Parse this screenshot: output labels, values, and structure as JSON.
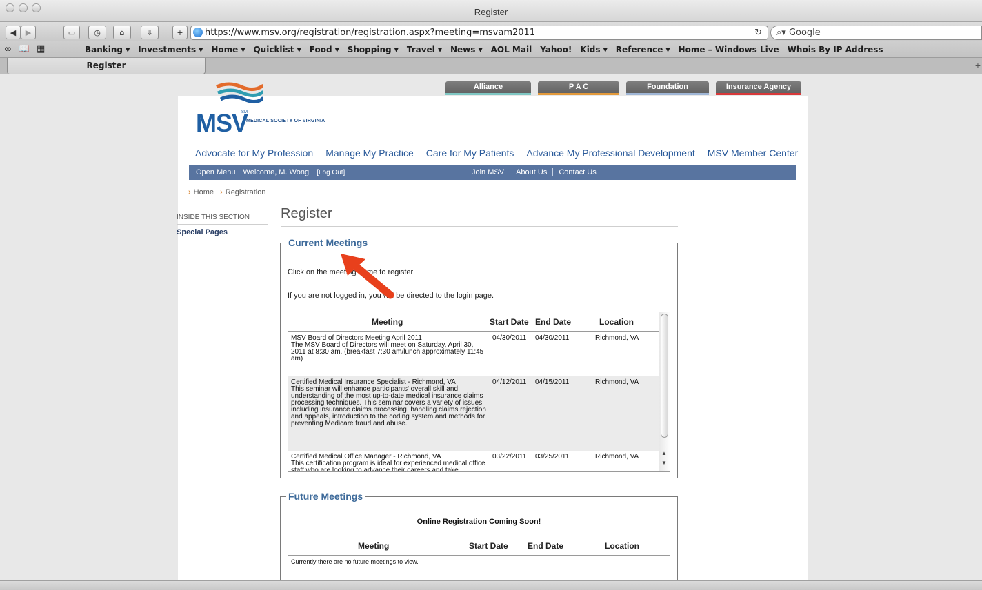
{
  "browser": {
    "window_title": "Register",
    "url": "https://www.msv.org/registration/registration.aspx?meeting=msvam2011",
    "search_placeholder": "Google",
    "bookmarks": [
      "Banking ▾",
      "Investments ▾",
      "Home ▾",
      "Quicklist ▾",
      "Food ▾",
      "Shopping ▾",
      "Travel ▾",
      "News ▾",
      "AOL Mail",
      "Yahoo!",
      "Kids ▾",
      "Reference ▾",
      "Home – Windows Live",
      "Whois By IP Address"
    ],
    "tab_title": "Register"
  },
  "affiliates": [
    {
      "label": "Alliance",
      "color": "#7fc7c3"
    },
    {
      "label": "P A C",
      "color": "#e39a3b"
    },
    {
      "label": "Foundation",
      "color": "#9fb6d6"
    },
    {
      "label": "Insurance Agency",
      "color": "#d8393a"
    }
  ],
  "logo": {
    "text": "MSV",
    "sm": "SM",
    "subtitle": "MEDICAL SOCIETY OF VIRGINIA"
  },
  "main_nav": [
    "Advocate for My Profession",
    "Manage My Practice",
    "Care for My Patients",
    "Advance My Professional Development",
    "MSV Member Center"
  ],
  "blue_bar": {
    "open_menu": "Open Menu",
    "welcome": "Welcome, M. Wong",
    "logout": "[Log Out]",
    "links": [
      "Join MSV",
      "About Us",
      "Contact Us"
    ]
  },
  "breadcrumb": [
    "Home",
    "Registration"
  ],
  "sidebar": {
    "heading": "INSIDE THIS SECTION",
    "link": "Special Pages"
  },
  "page_title": "Register",
  "current_meetings": {
    "legend": "Current Meetings",
    "instruction": "Click on the meeting name to register",
    "login_note": "If you are not logged in, you will be directed to the login page.",
    "columns": [
      "Meeting",
      "Start Date",
      "End Date",
      "Location"
    ],
    "rows": [
      {
        "title": "MSV Board of Directors Meeting April 2011",
        "desc": "The MSV Board of Directors will meet on Saturday, April 30, 2011 at 8:30 am. (breakfast 7:30 am/lunch approximately 11:45 am)",
        "start": "04/30/2011",
        "end": "04/30/2011",
        "location": "Richmond, VA"
      },
      {
        "title": "Certified Medical Insurance Specialist - Richmond, VA",
        "desc": "This seminar will enhance participants' overall skill and understanding of the most up-to-date medical insurance claims processing techniques. This seminar covers a variety of issues, including insurance claims processing, handling claims rejection and appeals, introduction to the coding system and methods for preventing Medicare fraud and abuse.",
        "start": "04/12/2011",
        "end": "04/15/2011",
        "location": "Richmond, VA"
      },
      {
        "title": "Certified Medical Office Manager - Richmond, VA",
        "desc": "This certification program is ideal for experienced medical office staff who are looking to advance their careers and take",
        "start": "03/22/2011",
        "end": "03/25/2011",
        "location": "Richmond, VA"
      }
    ]
  },
  "future_meetings": {
    "legend": "Future Meetings",
    "notice": "Online Registration Coming Soon!",
    "columns": [
      "Meeting",
      "Start Date",
      "End Date",
      "Location"
    ],
    "empty": "Currently there are no future meetings to view."
  },
  "annotation": {
    "arrow_color": "#e8401c"
  }
}
